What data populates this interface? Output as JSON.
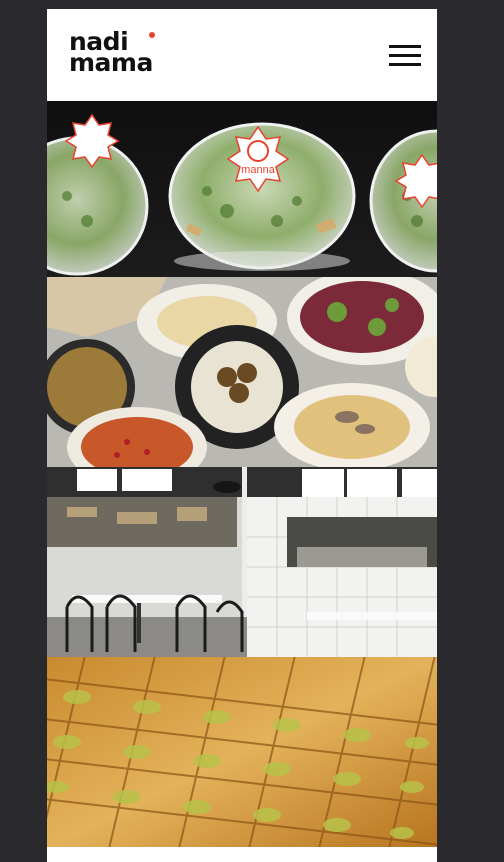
{
  "brand": {
    "logo_line1": "nadi",
    "logo_line2": "mama",
    "accent_color": "#e8432e"
  },
  "header": {
    "menu_icon": "hamburger-menu-icon"
  },
  "gallery": {
    "images": [
      {
        "subject": "packaged-salad-bowls",
        "sticker_text": "manna"
      },
      {
        "subject": "mezze-spread-table"
      },
      {
        "subject": "restaurant-interior"
      },
      {
        "subject": "baklava-tray"
      }
    ]
  }
}
